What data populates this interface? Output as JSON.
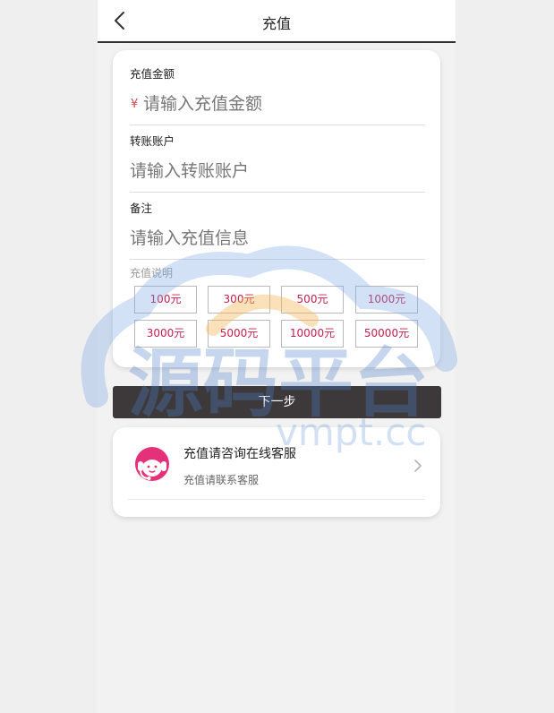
{
  "header": {
    "title": "充值"
  },
  "form": {
    "amount": {
      "label": "充值金额",
      "currency_symbol": "¥",
      "placeholder": "请输入充值金额"
    },
    "account": {
      "label": "转账账户",
      "placeholder": "请输入转账账户"
    },
    "note": {
      "label": "备注",
      "placeholder": "请输入充值信息"
    },
    "help_label": "充值说明",
    "amount_options": [
      "100元",
      "300元",
      "500元",
      "1000元",
      "3000元",
      "5000元",
      "10000元",
      "50000元"
    ]
  },
  "next_button": "下一步",
  "service": {
    "title": "充值请咨询在线客服",
    "subtitle": "充值请联系客服"
  },
  "watermark": {
    "brand_text": "源码平台",
    "url_text": "vmpt.cc"
  },
  "colors": {
    "accent": "#c41e4b",
    "button_dark": "#3d393b",
    "avatar_pink": "#e5307a"
  },
  "icons": {
    "back": "chevron-left-icon",
    "service": "headset-agent-icon",
    "arrow": "chevron-right-icon"
  }
}
